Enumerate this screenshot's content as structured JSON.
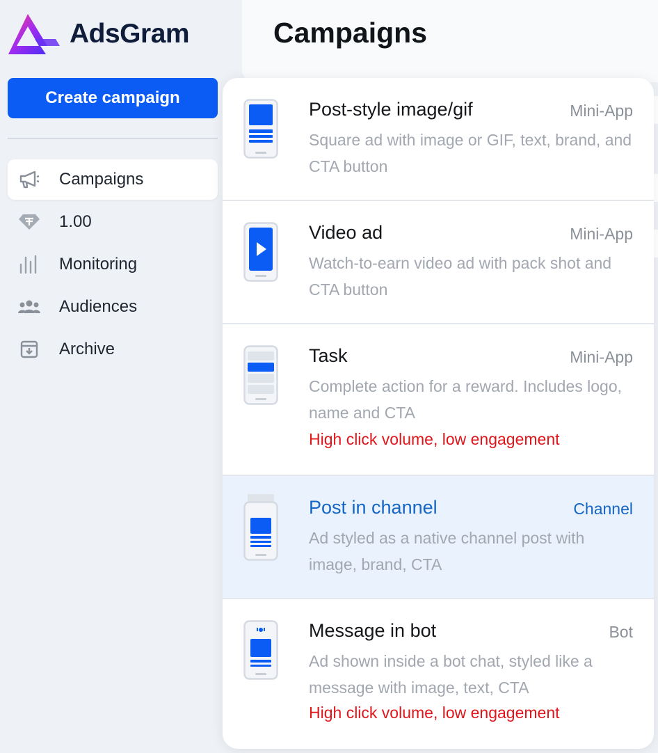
{
  "brand": {
    "name": "AdsGram"
  },
  "sidebar": {
    "create_button": "Create campaign",
    "items": [
      {
        "label": "Campaigns",
        "icon": "megaphone-icon",
        "active": true
      },
      {
        "label": "1.00",
        "icon": "diamond-icon",
        "active": false
      },
      {
        "label": "Monitoring",
        "icon": "bar-chart-icon",
        "active": false
      },
      {
        "label": "Audiences",
        "icon": "users-icon",
        "active": false
      },
      {
        "label": "Archive",
        "icon": "archive-icon",
        "active": false
      }
    ]
  },
  "header": {
    "title": "Campaigns"
  },
  "dropdown": {
    "options": [
      {
        "title": "Post-style image/gif",
        "tag": "Mini-App",
        "desc": "Square ad with image or GIF, text, brand, and CTA button",
        "warning": ""
      },
      {
        "title": "Video ad",
        "tag": "Mini-App",
        "desc": "Watch-to-earn video ad with pack shot and CTA button",
        "warning": ""
      },
      {
        "title": "Task",
        "tag": "Mini-App",
        "desc": "Complete action for a reward. Includes logo, name and CTA",
        "warning": "High click volume, low engagement"
      },
      {
        "title": "Post in channel",
        "tag": "Channel",
        "desc": "Ad styled as a native channel post with image, brand, CTA",
        "warning": ""
      },
      {
        "title": "Message in bot",
        "tag": "Bot",
        "desc": "Ad shown inside a bot chat, styled like a message with image, text, CTA",
        "warning": "High click volume, low engagement"
      }
    ]
  },
  "colors": {
    "accent": "#0a5cf5",
    "highlight_bg": "#eaf2fd",
    "highlight_text": "#1666c4",
    "warning": "#e0161b",
    "muted": "#a2a7b0"
  }
}
